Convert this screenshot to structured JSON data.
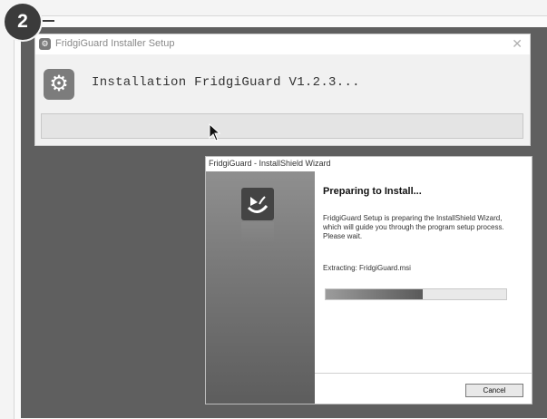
{
  "step": {
    "number": "2"
  },
  "setup_window": {
    "title": "FridgiGuard Installer Setup",
    "close_glyph": "✕",
    "app_icon": "gear-icon",
    "status_text": "Installation FridgiGuard V1.2.3..."
  },
  "wizard": {
    "title": "FridgiGuard - InstallShield Wizard",
    "heading": "Preparing to Install...",
    "description": "FridgiGuard Setup is preparing the InstallShield Wizard, which will guide you through the program setup process.  Please wait.",
    "extracting_text": "Extracting: FridgiGuard.msi",
    "progress_fraction": 0.54,
    "cancel_label": "Cancel"
  }
}
